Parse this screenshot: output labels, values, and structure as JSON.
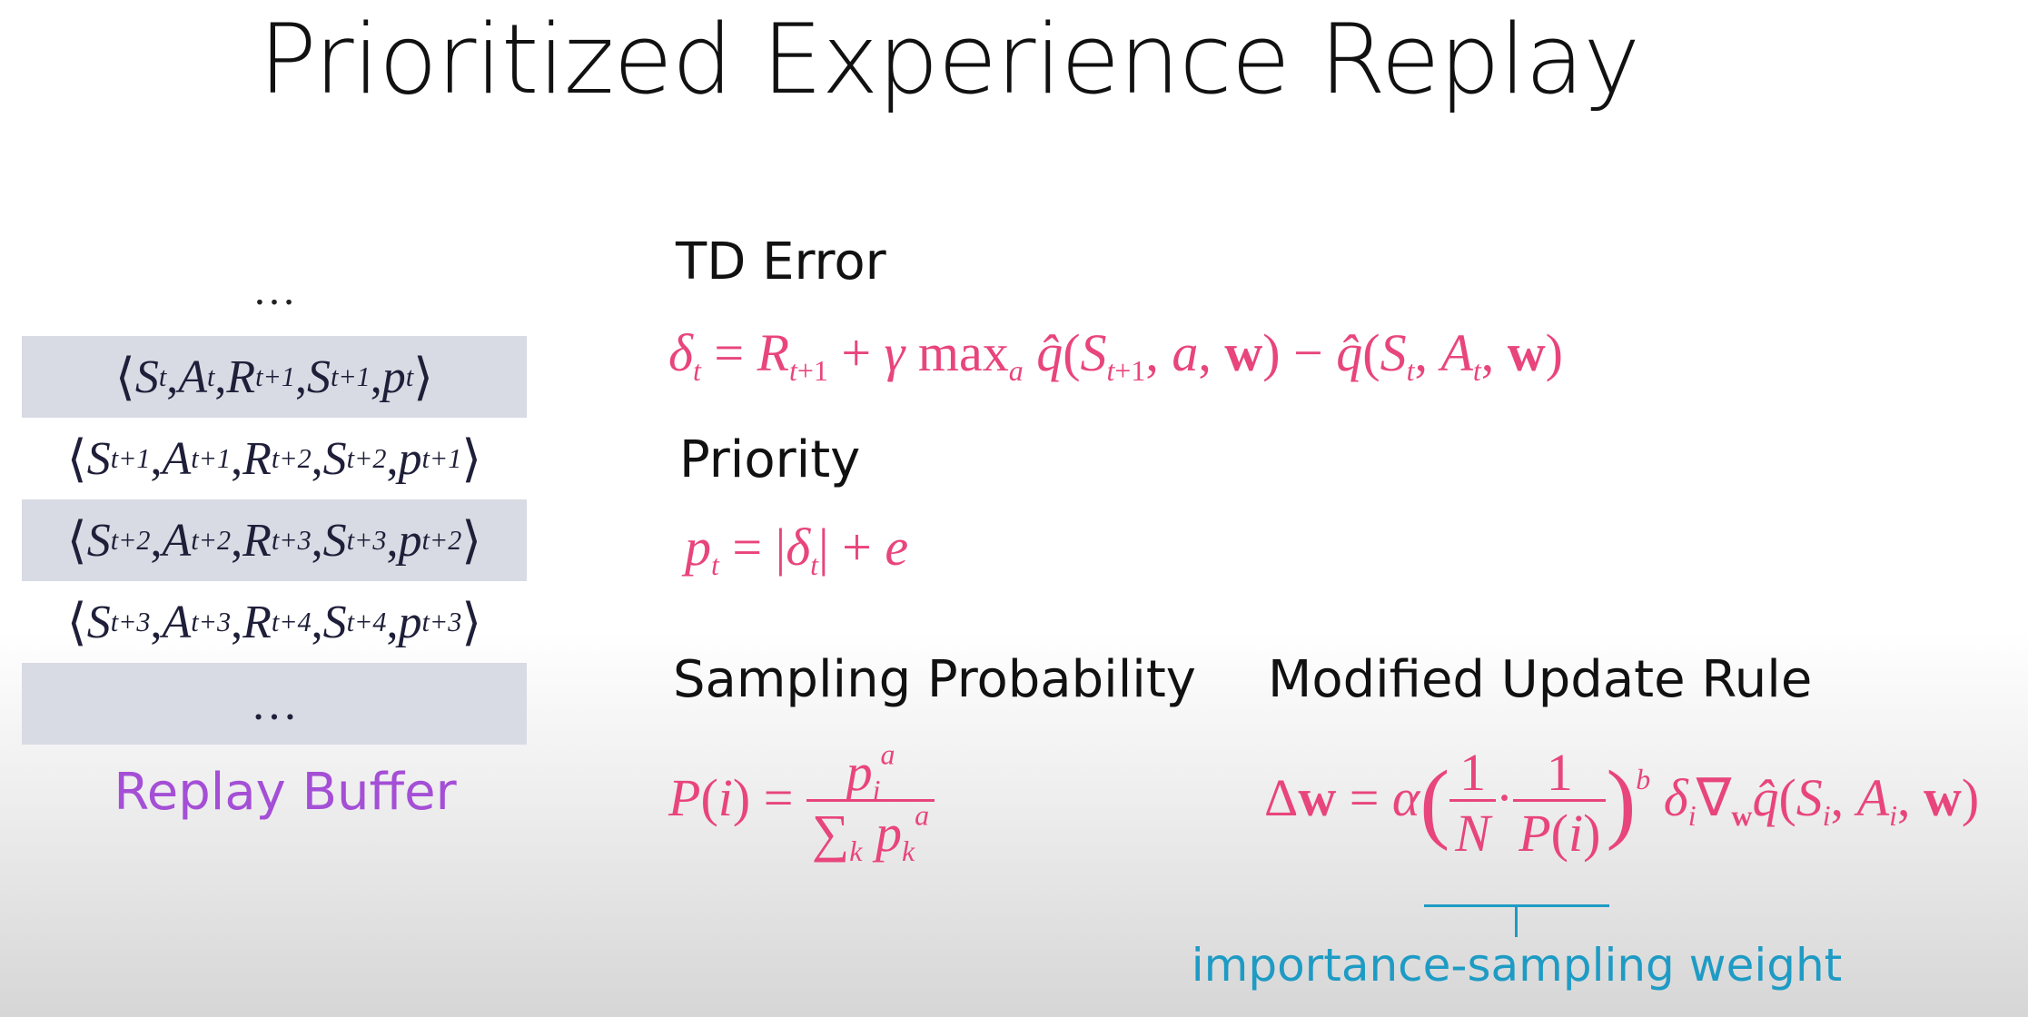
{
  "title": "Prioritized Experience Replay",
  "replay_buffer": {
    "label": "Replay Buffer",
    "top_ellipsis": "…",
    "bottom_ellipsis": "…",
    "row_fill_color": "#d8dbe3"
  },
  "sections": {
    "td_error": "TD Error",
    "priority": "Priority",
    "sampling_probability": "Sampling Probability",
    "modified_update_rule": "Modified Update Rule"
  },
  "annotation": {
    "importance_sampling": "importance-sampling weight"
  },
  "colors": {
    "formula": "#e8457c",
    "replay_label": "#a44fd6",
    "annotation": "#1e9bc4"
  }
}
